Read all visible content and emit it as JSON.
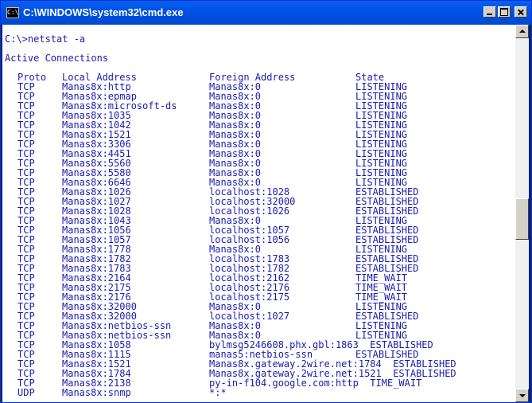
{
  "window": {
    "title": "C:\\WINDOWS\\system32\\cmd.exe",
    "icon": "cmd-icon",
    "icon_text": "C:\\"
  },
  "console": {
    "text_color": "#1a1ab0",
    "command_line": "C:\\>netstat -a",
    "section_title": "Active Connections",
    "headers": {
      "proto": "Proto",
      "local": "Local Address",
      "foreign": "Foreign Address",
      "state": "State"
    },
    "rows": [
      {
        "proto": "TCP",
        "local": "Manas8x:http",
        "foreign": "Manas8x:0",
        "state": "LISTENING"
      },
      {
        "proto": "TCP",
        "local": "Manas8x:epmap",
        "foreign": "Manas8x:0",
        "state": "LISTENING"
      },
      {
        "proto": "TCP",
        "local": "Manas8x:microsoft-ds",
        "foreign": "Manas8x:0",
        "state": "LISTENING"
      },
      {
        "proto": "TCP",
        "local": "Manas8x:1035",
        "foreign": "Manas8x:0",
        "state": "LISTENING"
      },
      {
        "proto": "TCP",
        "local": "Manas8x:1042",
        "foreign": "Manas8x:0",
        "state": "LISTENING"
      },
      {
        "proto": "TCP",
        "local": "Manas8x:1521",
        "foreign": "Manas8x:0",
        "state": "LISTENING"
      },
      {
        "proto": "TCP",
        "local": "Manas8x:3306",
        "foreign": "Manas8x:0",
        "state": "LISTENING"
      },
      {
        "proto": "TCP",
        "local": "Manas8x:4451",
        "foreign": "Manas8x:0",
        "state": "LISTENING"
      },
      {
        "proto": "TCP",
        "local": "Manas8x:5560",
        "foreign": "Manas8x:0",
        "state": "LISTENING"
      },
      {
        "proto": "TCP",
        "local": "Manas8x:5580",
        "foreign": "Manas8x:0",
        "state": "LISTENING"
      },
      {
        "proto": "TCP",
        "local": "Manas8x:6646",
        "foreign": "Manas8x:0",
        "state": "LISTENING"
      },
      {
        "proto": "TCP",
        "local": "Manas8x:1026",
        "foreign": "localhost:1028",
        "state": "ESTABLISHED"
      },
      {
        "proto": "TCP",
        "local": "Manas8x:1027",
        "foreign": "localhost:32000",
        "state": "ESTABLISHED"
      },
      {
        "proto": "TCP",
        "local": "Manas8x:1028",
        "foreign": "localhost:1026",
        "state": "ESTABLISHED"
      },
      {
        "proto": "TCP",
        "local": "Manas8x:1043",
        "foreign": "Manas8x:0",
        "state": "LISTENING"
      },
      {
        "proto": "TCP",
        "local": "Manas8x:1056",
        "foreign": "localhost:1057",
        "state": "ESTABLISHED"
      },
      {
        "proto": "TCP",
        "local": "Manas8x:1057",
        "foreign": "localhost:1056",
        "state": "ESTABLISHED"
      },
      {
        "proto": "TCP",
        "local": "Manas8x:1778",
        "foreign": "Manas8x:0",
        "state": "LISTENING"
      },
      {
        "proto": "TCP",
        "local": "Manas8x:1782",
        "foreign": "localhost:1783",
        "state": "ESTABLISHED"
      },
      {
        "proto": "TCP",
        "local": "Manas8x:1783",
        "foreign": "localhost:1782",
        "state": "ESTABLISHED"
      },
      {
        "proto": "TCP",
        "local": "Manas8x:2164",
        "foreign": "localhost:2162",
        "state": "TIME_WAIT"
      },
      {
        "proto": "TCP",
        "local": "Manas8x:2175",
        "foreign": "localhost:2176",
        "state": "TIME_WAIT"
      },
      {
        "proto": "TCP",
        "local": "Manas8x:2176",
        "foreign": "localhost:2175",
        "state": "TIME_WAIT"
      },
      {
        "proto": "TCP",
        "local": "Manas8x:32000",
        "foreign": "Manas8x:0",
        "state": "LISTENING"
      },
      {
        "proto": "TCP",
        "local": "Manas8x:32000",
        "foreign": "localhost:1027",
        "state": "ESTABLISHED"
      },
      {
        "proto": "TCP",
        "local": "Manas8x:netbios-ssn",
        "foreign": "Manas8x:0",
        "state": "LISTENING"
      },
      {
        "proto": "TCP",
        "local": "Manas8x:netbios-ssn",
        "foreign": "Manas8x:0",
        "state": "LISTENING"
      },
      {
        "proto": "TCP",
        "local": "Manas8x:1058",
        "foreign": "bylmsg5246608.phx.gbl:1863  ESTABLISHED",
        "state": ""
      },
      {
        "proto": "TCP",
        "local": "Manas8x:1115",
        "foreign": "manas5:netbios-ssn",
        "state": "ESTABLISHED"
      },
      {
        "proto": "TCP",
        "local": "Manas8x:1521",
        "foreign": "Manas8x.gateway.2wire.net:1784  ESTABLISHED",
        "state": ""
      },
      {
        "proto": "TCP",
        "local": "Manas8x:1784",
        "foreign": "Manas8x.gateway.2wire.net:1521  ESTABLISHED",
        "state": ""
      },
      {
        "proto": "TCP",
        "local": "Manas8x:2138",
        "foreign": "py-in-f104.google.com:http  TIME_WAIT",
        "state": ""
      },
      {
        "proto": "UDP",
        "local": "Manas8x:snmp",
        "foreign": "*:*",
        "state": ""
      }
    ]
  },
  "scrollbar": {
    "position_fraction": 0.48
  }
}
